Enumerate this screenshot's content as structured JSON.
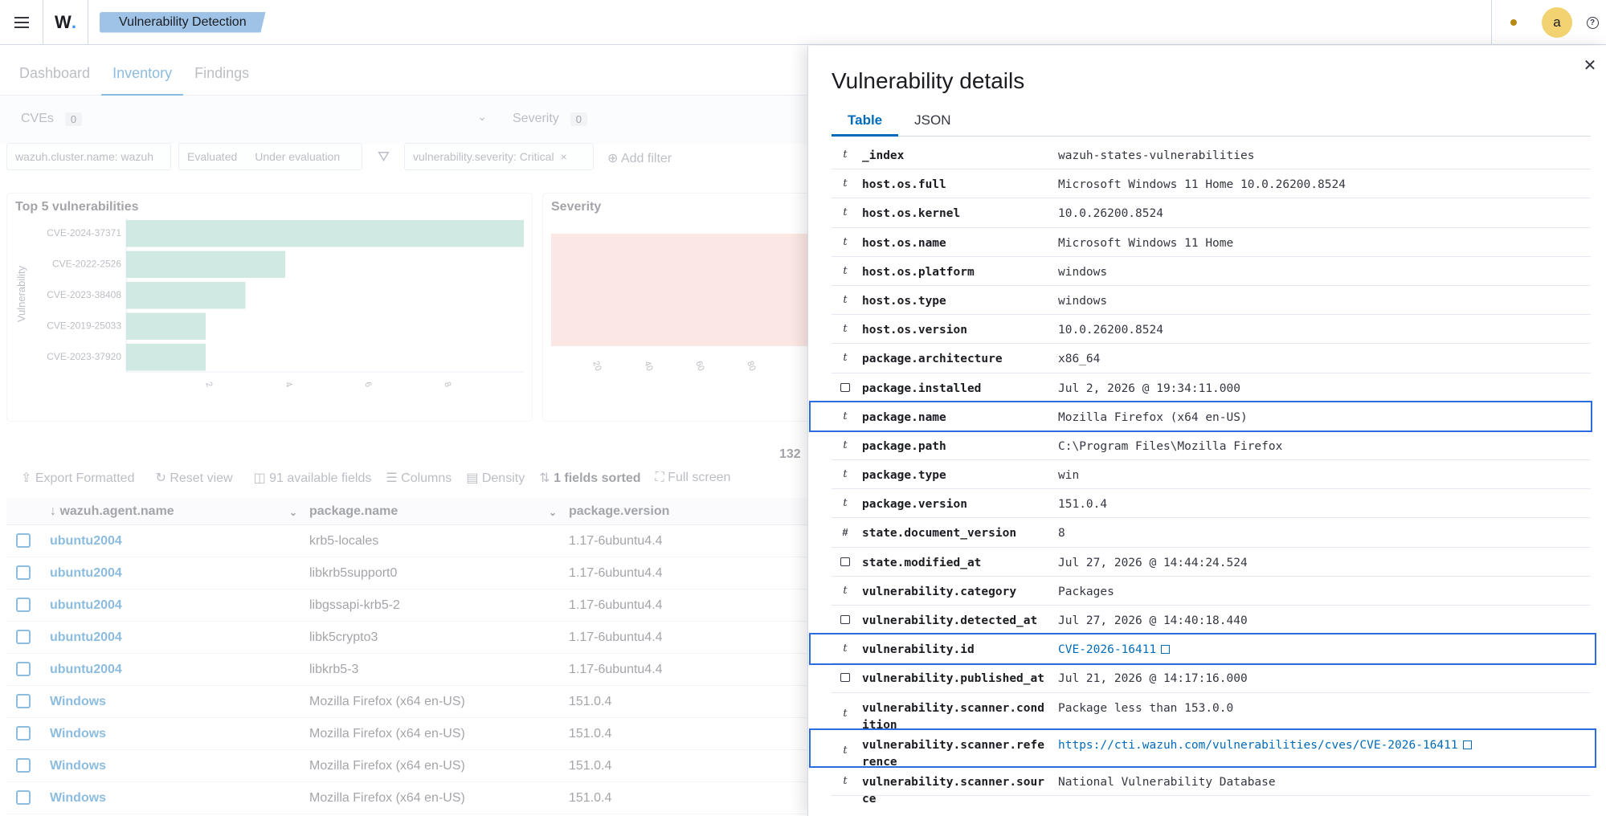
{
  "topbar": {
    "logo": "W",
    "breadcrumb": "Vulnerability Detection",
    "avatar_letter": "a",
    "help_glyph": "?"
  },
  "background": {
    "tabs": [
      "Dashboard",
      "Inventory",
      "Findings"
    ],
    "active_tab": "Inventory",
    "cves_label": "CVEs",
    "cves_count": "0",
    "severity_label": "Severity",
    "severity_count": "0",
    "filter_cluster": "wazuh.cluster.name: wazuh",
    "filter_evaluated": "Evaluated",
    "filter_under_eval": "Under evaluation",
    "filter_severity": "vulnerability.severity: Critical",
    "add_filter": "Add filter",
    "panel_top5_title": "Top 5 vulnerabilities",
    "panel_severity_title": "Severity",
    "hits_partial": "132",
    "toolbar": {
      "export": "Export Formatted",
      "reset": "Reset view",
      "fields": "91 available fields",
      "columns": "Columns",
      "density": "Density",
      "sorted": "1 fields sorted",
      "fullscreen": "Full screen"
    },
    "columns": [
      "wazuh.agent.name",
      "package.name",
      "package.version"
    ],
    "rows": [
      {
        "agent": "ubuntu2004",
        "package": "krb5-locales",
        "version": "1.17-6ubuntu4.4"
      },
      {
        "agent": "ubuntu2004",
        "package": "libkrb5support0",
        "version": "1.17-6ubuntu4.4"
      },
      {
        "agent": "ubuntu2004",
        "package": "libgssapi-krb5-2",
        "version": "1.17-6ubuntu4.4"
      },
      {
        "agent": "ubuntu2004",
        "package": "libk5crypto3",
        "version": "1.17-6ubuntu4.4"
      },
      {
        "agent": "ubuntu2004",
        "package": "libkrb5-3",
        "version": "1.17-6ubuntu4.4"
      },
      {
        "agent": "Windows",
        "package": "Mozilla Firefox (x64 en-US)",
        "version": "151.0.4"
      },
      {
        "agent": "Windows",
        "package": "Mozilla Firefox (x64 en-US)",
        "version": "151.0.4"
      },
      {
        "agent": "Windows",
        "package": "Mozilla Firefox (x64 en-US)",
        "version": "151.0.4"
      },
      {
        "agent": "Windows",
        "package": "Mozilla Firefox (x64 en-US)",
        "version": "151.0.4"
      }
    ]
  },
  "chart_data": [
    {
      "type": "bar",
      "orientation": "horizontal",
      "title": "Top 5 vulnerabilities",
      "ylabel": "Vulnerability",
      "categories": [
        "CVE-2024-37371",
        "CVE-2022-2526",
        "CVE-2023-38408",
        "CVE-2019-25033",
        "CVE-2023-37920"
      ],
      "values": [
        10,
        4,
        3,
        2,
        2
      ],
      "xticks": [
        "2",
        "4",
        "6",
        "8"
      ],
      "xlim": [
        0,
        10
      ],
      "color": "#54b399"
    },
    {
      "type": "bar",
      "title": "Severity",
      "xticks": [
        "20",
        "40",
        "60",
        "80"
      ],
      "color": "#e7664c"
    }
  ],
  "flyout": {
    "title": "Vulnerability details",
    "tabs": [
      "Table",
      "JSON"
    ],
    "active_tab": "Table",
    "close_glyph": "✕",
    "rows": [
      {
        "type": "t",
        "key": "_index",
        "value": "wazuh-states-vulnerabilities"
      },
      {
        "type": "t",
        "key": "host.os.full",
        "value": "Microsoft Windows 11 Home 10.0.26200.8524"
      },
      {
        "type": "t",
        "key": "host.os.kernel",
        "value": "10.0.26200.8524"
      },
      {
        "type": "t",
        "key": "host.os.name",
        "value": "Microsoft Windows 11 Home"
      },
      {
        "type": "t",
        "key": "host.os.platform",
        "value": "windows"
      },
      {
        "type": "t",
        "key": "host.os.type",
        "value": "windows"
      },
      {
        "type": "t",
        "key": "host.os.version",
        "value": "10.0.26200.8524"
      },
      {
        "type": "t",
        "key": "package.architecture",
        "value": "x86_64"
      },
      {
        "type": "date",
        "key": "package.installed",
        "value": "Jul 2, 2026 @ 19:34:11.000"
      },
      {
        "type": "t",
        "key": "package.name",
        "value": "Mozilla Firefox (x64 en-US)",
        "highlight": true
      },
      {
        "type": "t",
        "key": "package.path",
        "value": "C:\\Program Files\\Mozilla Firefox"
      },
      {
        "type": "t",
        "key": "package.type",
        "value": "win"
      },
      {
        "type": "t",
        "key": "package.version",
        "value": "151.0.4"
      },
      {
        "type": "#",
        "key": "state.document_version",
        "value": "8"
      },
      {
        "type": "date",
        "key": "state.modified_at",
        "value": "Jul 27, 2026 @ 14:44:24.524"
      },
      {
        "type": "t",
        "key": "vulnerability.category",
        "value": "Packages"
      },
      {
        "type": "date",
        "key": "vulnerability.detected_at",
        "value": "Jul 27, 2026 @ 14:40:18.440"
      },
      {
        "type": "t",
        "key": "vulnerability.id",
        "value": "CVE-2026-16411",
        "link": true,
        "highlight": true
      },
      {
        "type": "date",
        "key": "vulnerability.published_at",
        "value": "Jul 21, 2026 @ 14:17:16.000"
      },
      {
        "type": "t",
        "key": "vulnerability.scanner.condition",
        "value": "Package less than 153.0.0"
      },
      {
        "type": "t",
        "key": "vulnerability.scanner.reference",
        "value": "https://cti.wazuh.com/vulnerabilities/cves/CVE-2026-16411",
        "link": true,
        "highlight": true
      },
      {
        "type": "t",
        "key": "vulnerability.scanner.source",
        "value": "National Vulnerability Database"
      }
    ]
  }
}
